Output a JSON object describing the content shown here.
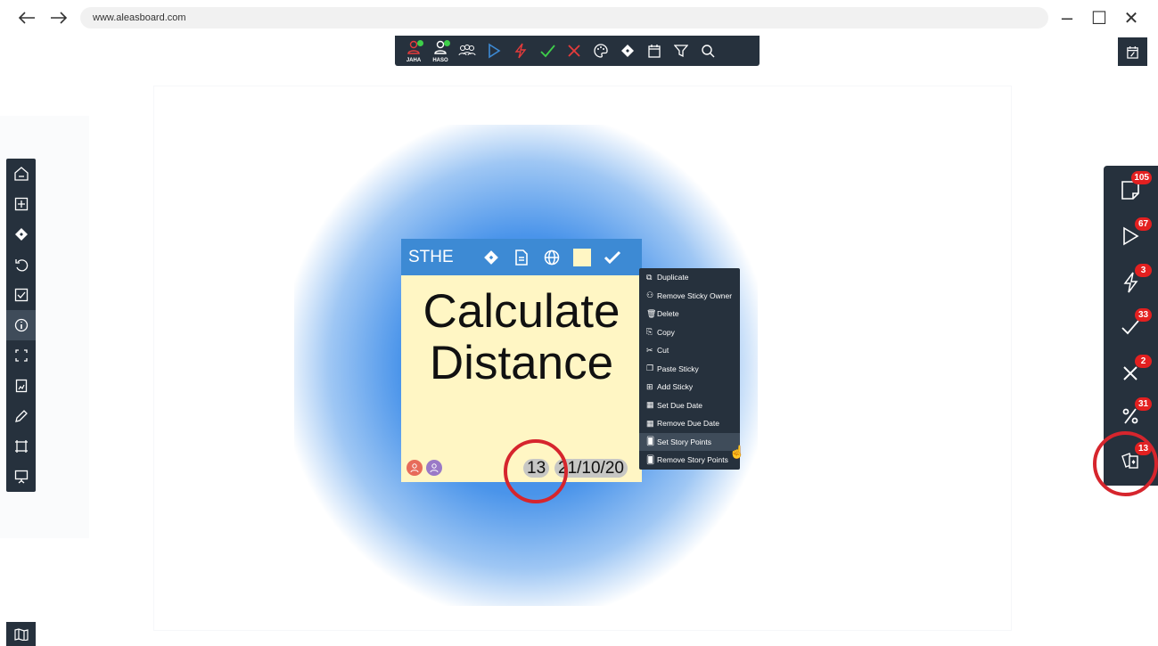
{
  "browser": {
    "back_icon": "arrow-left-icon",
    "forward_icon": "arrow-right-icon",
    "url": "www.aleasboard.com",
    "minimize_glyph": "–",
    "restore_glyph": "☐",
    "close_glyph": "✕"
  },
  "toolbar": {
    "items": [
      {
        "icon": "user-icon",
        "label": "JAHA",
        "status_color": "#3ecf4a"
      },
      {
        "icon": "user-icon",
        "label": "HASO",
        "status_color": "#3ecf4a"
      },
      {
        "icon": "users-icon"
      },
      {
        "icon": "play-icon",
        "color": "#3d8ad4"
      },
      {
        "icon": "bolt-icon",
        "color": "#e63b3b"
      },
      {
        "icon": "check-icon",
        "color": "#3ecf4a"
      },
      {
        "icon": "x-icon",
        "color": "#e63b3b"
      },
      {
        "icon": "palette-icon"
      },
      {
        "icon": "diamond-icon"
      },
      {
        "icon": "calendar-icon"
      },
      {
        "icon": "filter-icon"
      },
      {
        "icon": "search-icon"
      }
    ]
  },
  "left_toolbar": {
    "items": [
      "home-icon",
      "add-icon",
      "diamond-icon",
      "undo-icon",
      "checkbox-icon",
      "info-icon",
      "fullscreen-icon",
      "report-icon",
      "pencil-icon",
      "frame-icon",
      "presentation-icon"
    ],
    "active_index": 5
  },
  "right_panel": {
    "items": [
      {
        "icon": "sticky-icon",
        "count": "105"
      },
      {
        "icon": "play-icon",
        "count": "67"
      },
      {
        "icon": "bolt-icon",
        "count": "3"
      },
      {
        "icon": "check-icon",
        "count": "33"
      },
      {
        "icon": "x-icon",
        "count": "2"
      },
      {
        "icon": "percent-icon",
        "count": "31"
      },
      {
        "icon": "cards-icon",
        "count": "13"
      }
    ],
    "badge_color": "#e32020"
  },
  "sticky": {
    "owner": "STHE",
    "line1": "Calculate",
    "line2": "Distance",
    "story_points": "13",
    "due_date": "21/10/20",
    "header_color": "#3d8ad4",
    "body_color": "#fff6c4"
  },
  "context_menu": {
    "items": [
      {
        "icon": "duplicate-icon",
        "label": "Duplicate"
      },
      {
        "icon": "user-icon",
        "label": "Remove Sticky Owner"
      },
      {
        "icon": "trash-icon",
        "label": "Delete"
      },
      {
        "icon": "copy-icon",
        "label": "Copy"
      },
      {
        "icon": "scissors-icon",
        "label": "Cut"
      },
      {
        "icon": "paste-icon",
        "label": "Paste Sticky"
      },
      {
        "icon": "add-icon",
        "label": "Add Sticky"
      },
      {
        "icon": "calendar-icon",
        "label": "Set Due Date"
      },
      {
        "icon": "calendar-icon",
        "label": "Remove Due Date"
      },
      {
        "icon": "cards-icon",
        "label": "Set Story Points"
      },
      {
        "icon": "cards-icon",
        "label": "Remove Story Points"
      }
    ],
    "highlighted_index": 9
  },
  "highlight_color": "#d6252d"
}
